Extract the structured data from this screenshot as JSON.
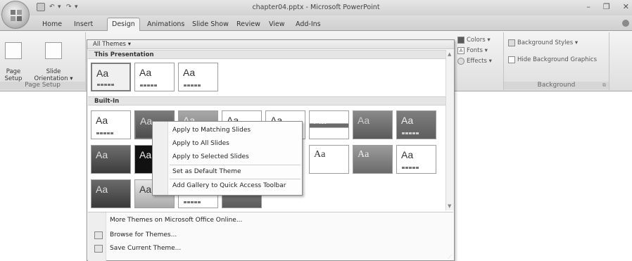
{
  "window": {
    "title": "chapter04.pptx - Microsoft PowerPoint",
    "minimize": "–",
    "restore": "❐",
    "close": "✕"
  },
  "qat": {
    "more": "▾"
  },
  "tabs": [
    "Home",
    "Insert",
    "Design",
    "Animations",
    "Slide Show",
    "Review",
    "View",
    "Add-Ins"
  ],
  "active_tab": "Design",
  "ribbon": {
    "page_setup": {
      "label": "Page Setup",
      "page_setup_btn": "Page\nSetup",
      "orientation_btn": "Slide\nOrientation ▾"
    },
    "themes": {
      "colors": "Colors ▾",
      "fonts": "Fonts ▾",
      "effects": "Effects ▾"
    },
    "background": {
      "label": "Background",
      "styles": "Background Styles ▾",
      "hide_graphics": "Hide Background Graphics"
    }
  },
  "gallery": {
    "header": "All Themes ▾",
    "this_presentation": "This Presentation",
    "built_in": "Built-In",
    "thumb_text": "Aa",
    "menu": {
      "more_online": "More Themes on Microsoft Office Online...",
      "browse": "Browse for Themes...",
      "save_current": "Save Current Theme..."
    }
  },
  "context_menu": {
    "items": [
      "Apply to Matching Slides",
      "Apply to All Slides",
      "Apply to Selected Slides",
      "Set as Default Theme",
      "Add Gallery to Quick Access Toolbar"
    ]
  },
  "colors": {
    "gray_dark": "#5a5a5a",
    "gray_mid": "#8c8c8c",
    "gray_light": "#c9c9c9"
  }
}
